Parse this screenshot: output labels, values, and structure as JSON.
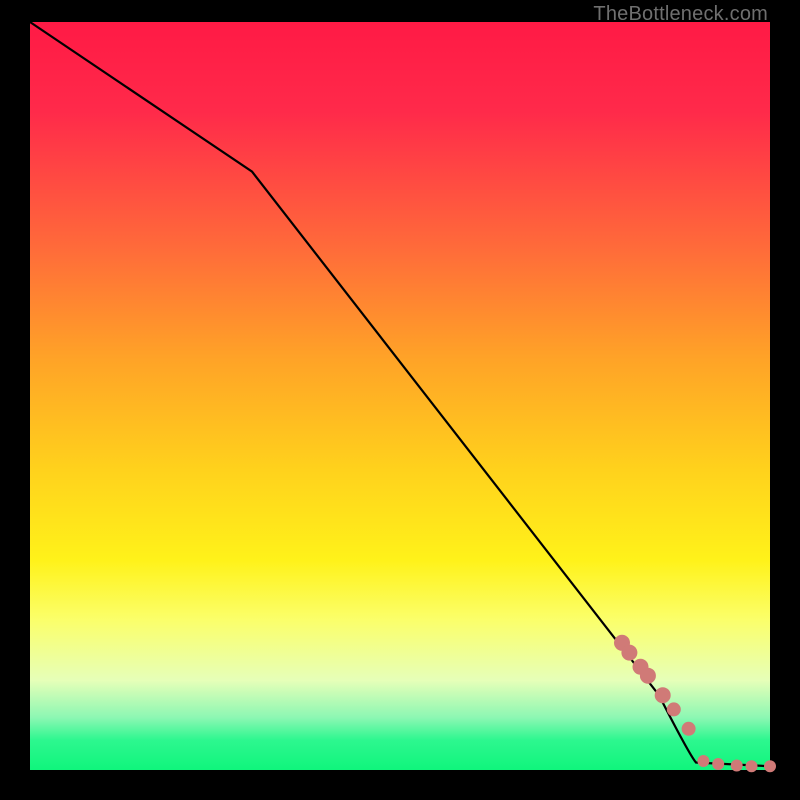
{
  "watermark_text": "TheBottleneck.com",
  "colors": {
    "background": "#000000",
    "curve_stroke": "#000000",
    "marker_fill": "#d07a77",
    "gradient_stops": [
      {
        "offset": 0.0,
        "color": "#ff1a45"
      },
      {
        "offset": 0.12,
        "color": "#ff2a4a"
      },
      {
        "offset": 0.3,
        "color": "#ff6a3a"
      },
      {
        "offset": 0.45,
        "color": "#ffa327"
      },
      {
        "offset": 0.6,
        "color": "#ffd21c"
      },
      {
        "offset": 0.72,
        "color": "#fff21a"
      },
      {
        "offset": 0.8,
        "color": "#fbff6b"
      },
      {
        "offset": 0.88,
        "color": "#e6ffb8"
      },
      {
        "offset": 0.93,
        "color": "#8cf7b3"
      },
      {
        "offset": 0.96,
        "color": "#2df78f"
      },
      {
        "offset": 1.0,
        "color": "#10f57c"
      }
    ]
  },
  "chart_data": {
    "type": "line",
    "title": "",
    "xlabel": "",
    "ylabel": "",
    "x_range": [
      0,
      100
    ],
    "y_range": [
      0,
      100
    ],
    "series": [
      {
        "name": "curve",
        "kind": "line",
        "x": [
          0,
          30,
          85,
          90,
          100
        ],
        "y": [
          100,
          80,
          10,
          1,
          0.5
        ]
      },
      {
        "name": "markers",
        "kind": "scatter",
        "x": [
          80,
          81,
          82.5,
          83.5,
          85.5,
          87,
          89,
          91,
          93,
          95.5,
          97.5,
          100
        ],
        "y": [
          17,
          15.7,
          13.8,
          12.6,
          10,
          8.1,
          5.5,
          1.2,
          0.8,
          0.6,
          0.5,
          0.5
        ]
      }
    ]
  }
}
